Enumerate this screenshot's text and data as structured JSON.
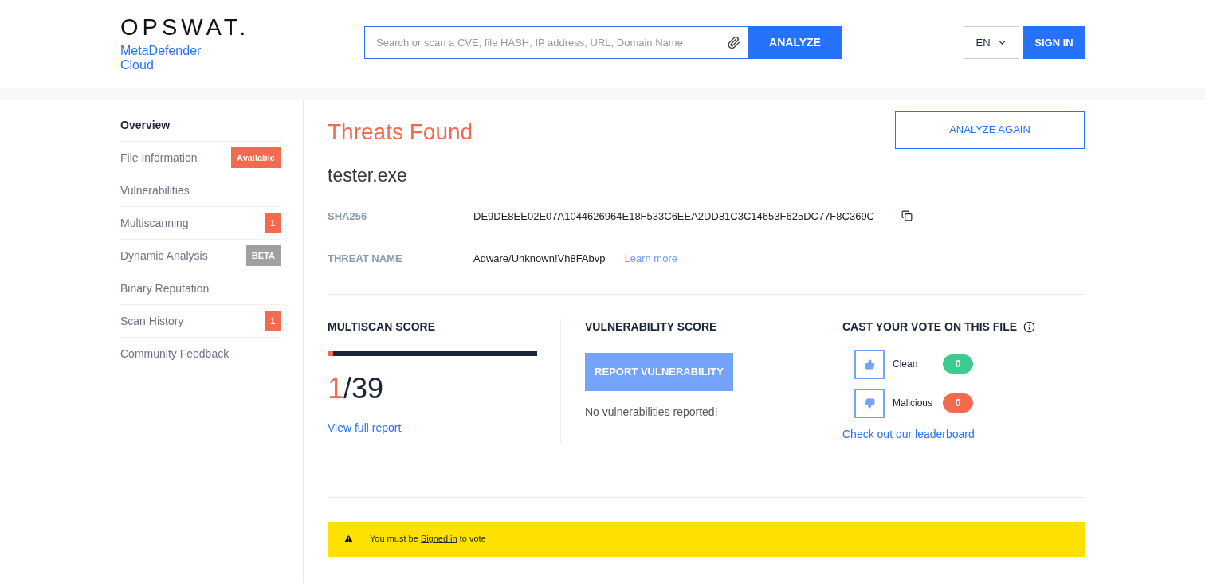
{
  "header": {
    "logo": "OPSWAT.",
    "product": [
      "MetaDefender",
      "Cloud"
    ],
    "search": {
      "placeholder": "Search or scan a CVE, file HASH, IP address, URL, Domain Name"
    },
    "analyze_button": "ANALYZE",
    "language": "EN",
    "sign_in": "SIGN IN"
  },
  "sidebar": {
    "items": [
      {
        "label": "Overview",
        "selected": true
      },
      {
        "label": "File Information",
        "selected": false,
        "badge": {
          "text": "Available",
          "color": "#f26b4f"
        }
      },
      {
        "label": "Vulnerabilities",
        "selected": false
      },
      {
        "label": "Multiscanning",
        "selected": false,
        "badge": {
          "text": "1",
          "color": "#f26b4f"
        }
      },
      {
        "label": "Dynamic Analysis",
        "selected": false,
        "badge": {
          "text": "BETA",
          "color": "#a0a0a0"
        }
      },
      {
        "label": "Binary Reputation",
        "selected": false
      },
      {
        "label": "Scan History",
        "selected": false,
        "badge": {
          "text": "1",
          "color": "#f26b4f"
        }
      },
      {
        "label": "Community Feedback",
        "selected": false
      }
    ]
  },
  "main": {
    "status": "Threats Found",
    "analyze_again": "ANALYZE AGAIN",
    "file_name": "tester.exe",
    "details": [
      {
        "label": "SHA256",
        "value": "DE9DE8EE02E07A1044626964E18F533C6EEA2DD81C3C14653F625DC77F8C369C",
        "kind": "hash"
      },
      {
        "label": "THREAT NAME",
        "value": "Adware/Unknown!Vh8FAbvp",
        "kind": "threat",
        "link": "Learn more"
      }
    ],
    "multiscan": {
      "title": "MULTISCAN SCORE",
      "level": 0.026,
      "detected": "1",
      "total": "/39",
      "link": "View full report"
    },
    "vulnerability": {
      "title": "VULNERABILITY SCORE",
      "button": "REPORT VULNERABILITY",
      "message": "No vulnerabilities reported!"
    },
    "vote": {
      "title": "CAST YOUR VOTE ON THIS FILE",
      "options": [
        {
          "kind": "up",
          "label": "Clean",
          "count": "0",
          "color": "#3ecb8f"
        },
        {
          "kind": "down",
          "label": "Malicious",
          "count": "0",
          "color": "#f26b4f"
        }
      ],
      "link": "Check out our leaderboard"
    },
    "notice": {
      "before": "You must be",
      "link": "Signed in",
      "after": "to vote"
    }
  }
}
